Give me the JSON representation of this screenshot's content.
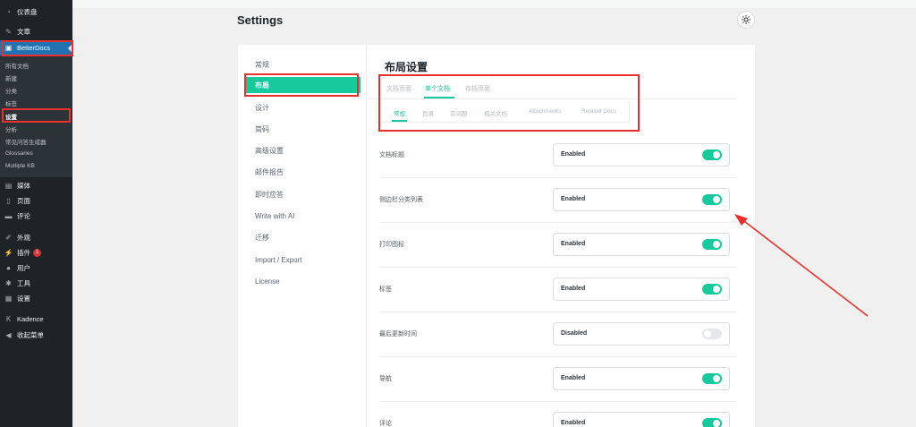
{
  "wp_menu": {
    "dashboard": "仪表盘",
    "posts": "文章",
    "betterdocs": "BetterDocs",
    "betterdocs_sub": [
      "所有文档",
      "新建",
      "分类",
      "标签",
      "设置",
      "分析",
      "常见问答生成器",
      "Glossaries",
      "Multiple KB"
    ],
    "media": "媒体",
    "pages": "页面",
    "comments": "评论",
    "appearance": "外观",
    "plugins": "插件",
    "plugins_badge": "1",
    "users": "用户",
    "tools": "工具",
    "settings": "设置",
    "kadence": "Kadence",
    "collapse": "收起菜单"
  },
  "page": {
    "title": "Settings"
  },
  "settings_nav": [
    "常规",
    "布局",
    "设计",
    "简码",
    "高级设置",
    "邮件报告",
    "即时应答",
    "Write with AI",
    "迁移",
    "Import / Export",
    "License"
  ],
  "layout": {
    "title": "布局设置",
    "tabs": [
      "文档页面",
      "单个文档",
      "存档页面"
    ],
    "subtabs": [
      "常规",
      "目录",
      "首词题",
      "相关文档",
      "Attachments",
      "Related Docs"
    ],
    "rows": [
      {
        "label": "文档标题",
        "value": "Enabled",
        "on": true
      },
      {
        "label": "侧边栏分类列表",
        "value": "Enabled",
        "on": true
      },
      {
        "label": "打印图标",
        "value": "Enabled",
        "on": true
      },
      {
        "label": "标签",
        "value": "Enabled",
        "on": true
      },
      {
        "label": "最后更新时间",
        "value": "Disabled",
        "on": false
      },
      {
        "label": "导航",
        "value": "Enabled",
        "on": true
      },
      {
        "label": "评论",
        "value": "Enabled",
        "on": true
      }
    ]
  },
  "colors": {
    "accent": "#16ca9e",
    "wp_sidebar": "#1d2327",
    "wp_active": "#2271b1",
    "annotation": "#e8312d"
  }
}
